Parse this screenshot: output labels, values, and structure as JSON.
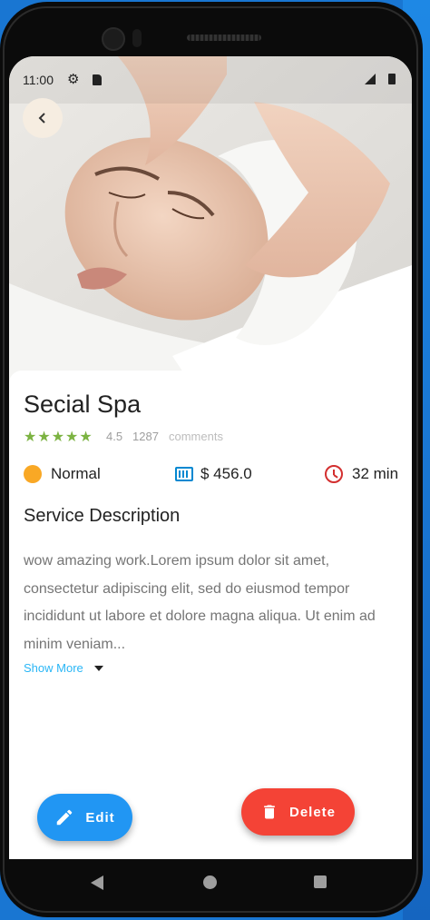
{
  "status_bar": {
    "time": "11:00",
    "gear_icon": "gear-icon",
    "sd_icon": "sd-card-icon"
  },
  "hero": {
    "image_desc": "spa facial massage photo"
  },
  "service": {
    "title": "Secial Spa",
    "stars": "★★★★★",
    "rating": "4.5",
    "review_count": "1287",
    "comments_label": "comments",
    "level": "Normal",
    "price": "$ 456.0",
    "duration": "32 min",
    "section_title": "Service Description",
    "description": "wow amazing work.Lorem ipsum dolor sit amet, consectetur adipiscing elit, sed do eiusmod tempor incididunt ut labore et dolore magna aliqua. Ut enim ad minim veniam...",
    "show_more": "Show More"
  },
  "actions": {
    "edit_label": "Edit",
    "delete_label": "Delete"
  },
  "colors": {
    "edit": "#2196f3",
    "delete": "#f44336",
    "stars": "#7cb342",
    "level_dot": "#f9a825",
    "price_icon": "#0288d1",
    "clock_icon": "#d32f2f",
    "link": "#29b6f6"
  }
}
